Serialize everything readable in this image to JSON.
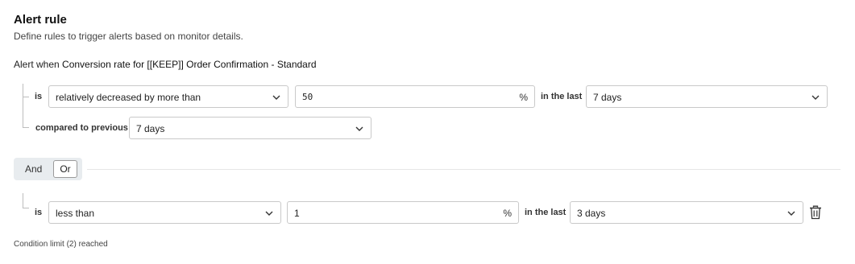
{
  "header": {
    "title": "Alert rule",
    "subtitle": "Define rules to trigger alerts based on monitor details."
  },
  "alert_when": {
    "prefix": "Alert when",
    "metric": "Conversion rate for [[KEEP]] Order Confirmation - Standard"
  },
  "condition1": {
    "is_label": "is",
    "operator": "relatively decreased by more than",
    "value": "50",
    "unit": "%",
    "in_last_label": "in the last",
    "window": "7 days",
    "compared_label": "compared to previous",
    "compare_window": "7 days"
  },
  "logic": {
    "and_label": "And",
    "or_label": "Or",
    "selected": "Or"
  },
  "condition2": {
    "is_label": "is",
    "operator": "less than",
    "value": "1",
    "unit": "%",
    "in_last_label": "in the last",
    "window": "3 days"
  },
  "footer": {
    "limit_text": "Condition limit (2) reached"
  }
}
